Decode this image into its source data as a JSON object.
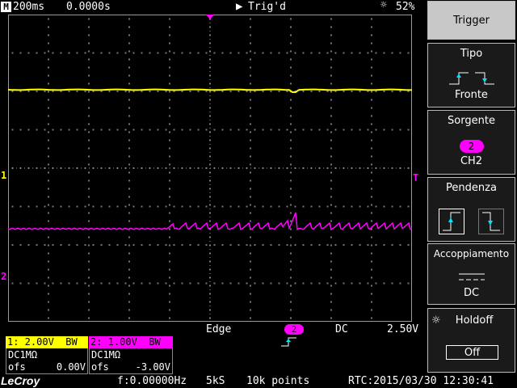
{
  "status": {
    "mode_glyph": "M",
    "timebase": "200ms",
    "delay": "0.0000s",
    "trigger_state": "Trig'd",
    "battery": "52%"
  },
  "markers": {
    "ch1": "1",
    "ch2": "2",
    "trigger_level": "T"
  },
  "trigger_info": {
    "type": "Edge",
    "source": "2",
    "coupling": "DC",
    "level": "2.50V"
  },
  "channels": [
    {
      "header": "1: 2.00V  BW",
      "coupling": "DC1MΩ",
      "ofs_label": "ofs",
      "ofs_value": "0.00V",
      "color": "#ffff00"
    },
    {
      "header": "2: 1.00V  BW",
      "coupling": "DC1MΩ",
      "ofs_label": "ofs",
      "ofs_value": "-3.00V",
      "color": "#ff00ff"
    }
  ],
  "footer": {
    "logo": "LeCroy",
    "frequency": "f:0.00000Hz",
    "sample_rate": "5kS",
    "points": "10k points",
    "rtc": "RTC:2015/03/30 12:30:41"
  },
  "menu": {
    "title": "Trigger",
    "tipo_label": "Tipo",
    "tipo_value": "Fronte",
    "sorgente_label": "Sorgente",
    "sorgente_badge": "2",
    "sorgente_value": "CH2",
    "pendenza_label": "Pendenza",
    "accoppiamento_label": "Accoppiamento",
    "accoppiamento_value": "DC",
    "holdoff_label": "Holdoff",
    "holdoff_value": "Off"
  }
}
